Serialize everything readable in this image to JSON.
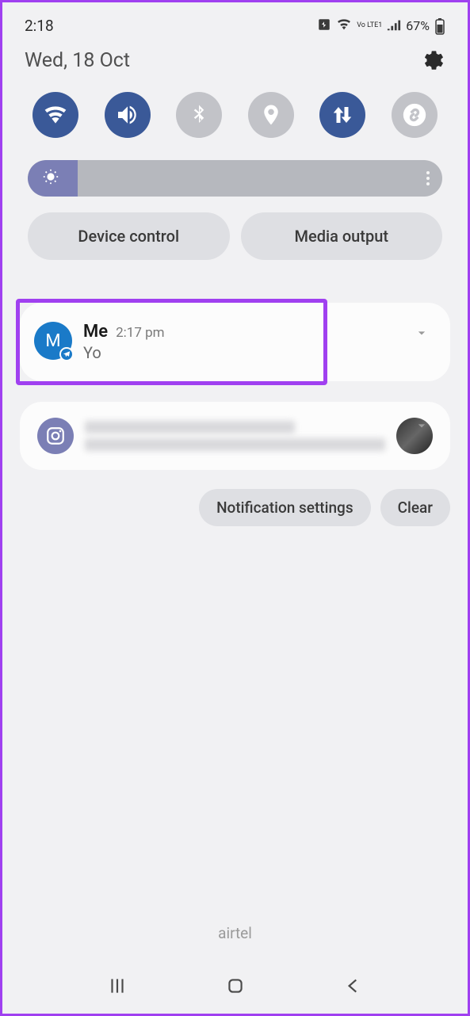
{
  "status": {
    "time": "2:18",
    "battery_percent": "67%",
    "network_label": "Vo LTE1"
  },
  "header": {
    "date": "Wed, 18 Oct"
  },
  "quick_settings": {
    "toggles": [
      {
        "name": "wifi",
        "active": true
      },
      {
        "name": "sound",
        "active": true
      },
      {
        "name": "bluetooth",
        "active": false
      },
      {
        "name": "location",
        "active": false
      },
      {
        "name": "data-sync",
        "active": true
      },
      {
        "name": "shazam",
        "active": false
      }
    ]
  },
  "brightness": {
    "level_percent": 12
  },
  "controls": {
    "device": "Device control",
    "media": "Media output"
  },
  "notifications": [
    {
      "avatar_letter": "M",
      "app": "telegram",
      "sender": "Me",
      "time": "2:17 pm",
      "message": "Yo",
      "highlighted": true
    },
    {
      "app": "instagram",
      "blurred": true
    }
  ],
  "actions": {
    "settings": "Notification settings",
    "clear": "Clear"
  },
  "carrier": "airtel"
}
